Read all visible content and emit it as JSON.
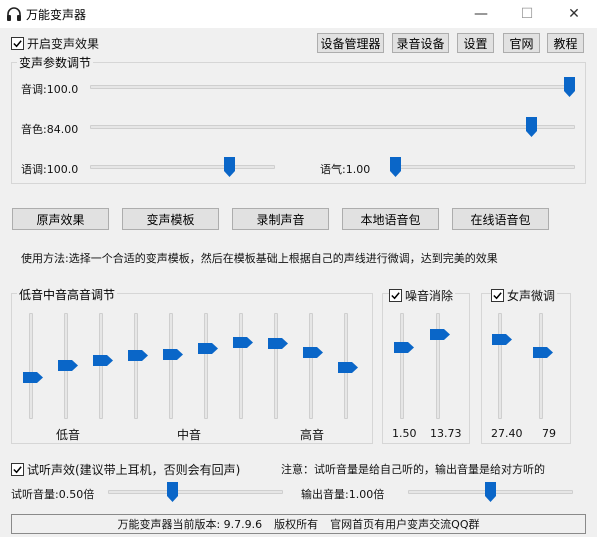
{
  "window": {
    "title": "万能变声器",
    "minimize_glyph": "—",
    "maximize_glyph": "☐",
    "close_glyph": "✕"
  },
  "header": {
    "enable_checkbox": {
      "label": "开启变声效果",
      "checked": true
    },
    "buttons": [
      "设备管理器",
      "录音设备",
      "设置",
      "官网",
      "教程"
    ]
  },
  "voice_params": {
    "title": "变声参数调节",
    "pitch": {
      "label": "音调:100.0",
      "value": 100.0,
      "fraction": 1.0
    },
    "timbre": {
      "label": "音色:84.00",
      "value": 84.0,
      "fraction": 0.92
    },
    "speed": {
      "label": "语调:100.0",
      "value": 100.0,
      "fraction": 0.77
    },
    "tone": {
      "label": "语气:1.00",
      "value": 1.0,
      "fraction": 0.0
    }
  },
  "mode_buttons": [
    "原声效果",
    "变声模板",
    "录制声音",
    "本地语音包",
    "在线语音包"
  ],
  "usage_text": "使用方法:选择一个合适的变声模板，然后在模板基础上根据自己的声线进行微调，达到完美的效果",
  "eq": {
    "title": "低音中音高音调节",
    "bands_fraction": [
      0.38,
      0.51,
      0.56,
      0.61,
      0.62,
      0.68,
      0.75,
      0.74,
      0.64,
      0.48
    ],
    "labels": {
      "low": "低音",
      "mid": "中音",
      "high": "高音"
    }
  },
  "noise": {
    "title": "噪音消除",
    "checked": true,
    "values": [
      "1.50",
      "13.73"
    ],
    "fractions": [
      0.7,
      0.83
    ]
  },
  "female": {
    "title": "女声微调",
    "checked": true,
    "values": [
      "27.40",
      "79"
    ],
    "fractions": [
      0.78,
      0.64
    ]
  },
  "monitor": {
    "checkbox": {
      "label": "试听声效(建议带上耳机，否则会有回声)",
      "checked": true
    },
    "note": "注意：试听音量是给自己听的，输出音量是给对方听的",
    "listen_volume": {
      "label": "试听音量:0.50倍",
      "value": 0.5,
      "fraction": 0.36
    },
    "output_volume": {
      "label": "输出音量:1.00倍",
      "value": 1.0,
      "fraction": 0.5
    }
  },
  "footer": {
    "version": "万能变声器当前版本: 9.7.9.6",
    "copyright": "版权所有",
    "qq": "官网首页有用户变声交流QQ群"
  },
  "colors": {
    "accent": "#0a66c8",
    "window_bg": "#f0f0f0",
    "button_bg": "#e1e1e1"
  }
}
